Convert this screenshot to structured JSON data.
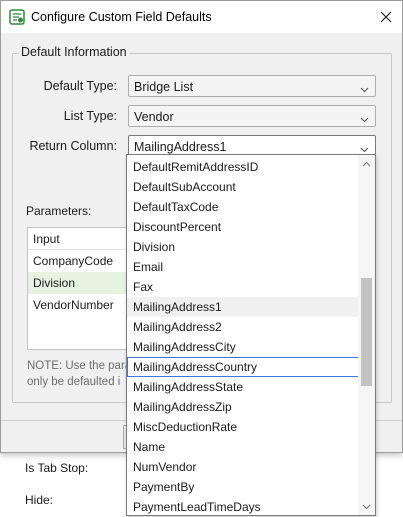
{
  "dialog": {
    "title": "Configure Custom Field Defaults",
    "app_icon": "app-icon",
    "close_icon": "close-icon"
  },
  "group": {
    "title": "Default Information"
  },
  "fields": {
    "default_type": {
      "label": "Default Type:",
      "value": "Bridge List"
    },
    "list_type": {
      "label": "List Type:",
      "value": "Vendor"
    },
    "return_column": {
      "label": "Return Column:",
      "value": "MailingAddress1"
    }
  },
  "parameters": {
    "label": "Parameters:",
    "header": "Input",
    "rows": [
      "CompanyCode",
      "Division",
      "VendorNumber"
    ],
    "selected_row": "Division"
  },
  "note": {
    "line1": "NOTE: Use the para",
    "line2": "only be defaulted i"
  },
  "underlay": {
    "tab_stop_label": "Is Tab Stop:",
    "hide_label": "Hide:"
  },
  "dropdown": {
    "items": [
      "DefaultRemitAddressID",
      "DefaultSubAccount",
      "DefaultTaxCode",
      "DiscountPercent",
      "Division",
      "Email",
      "Fax",
      "MailingAddress1",
      "MailingAddress2",
      "MailingAddressCity",
      "MailingAddressCountry",
      "MailingAddressState",
      "MailingAddressZip",
      "MiscDeductionRate",
      "Name",
      "NumVendor",
      "PaymentBy",
      "PaymentLeadTimeDays"
    ],
    "current": "MailingAddress1",
    "hovered": "MailingAddressCountry"
  },
  "colors": {
    "selected_row_bg": "#e6f3e0",
    "focus_border": "#3c78d8",
    "dialog_bg": "#f0f0f0"
  }
}
